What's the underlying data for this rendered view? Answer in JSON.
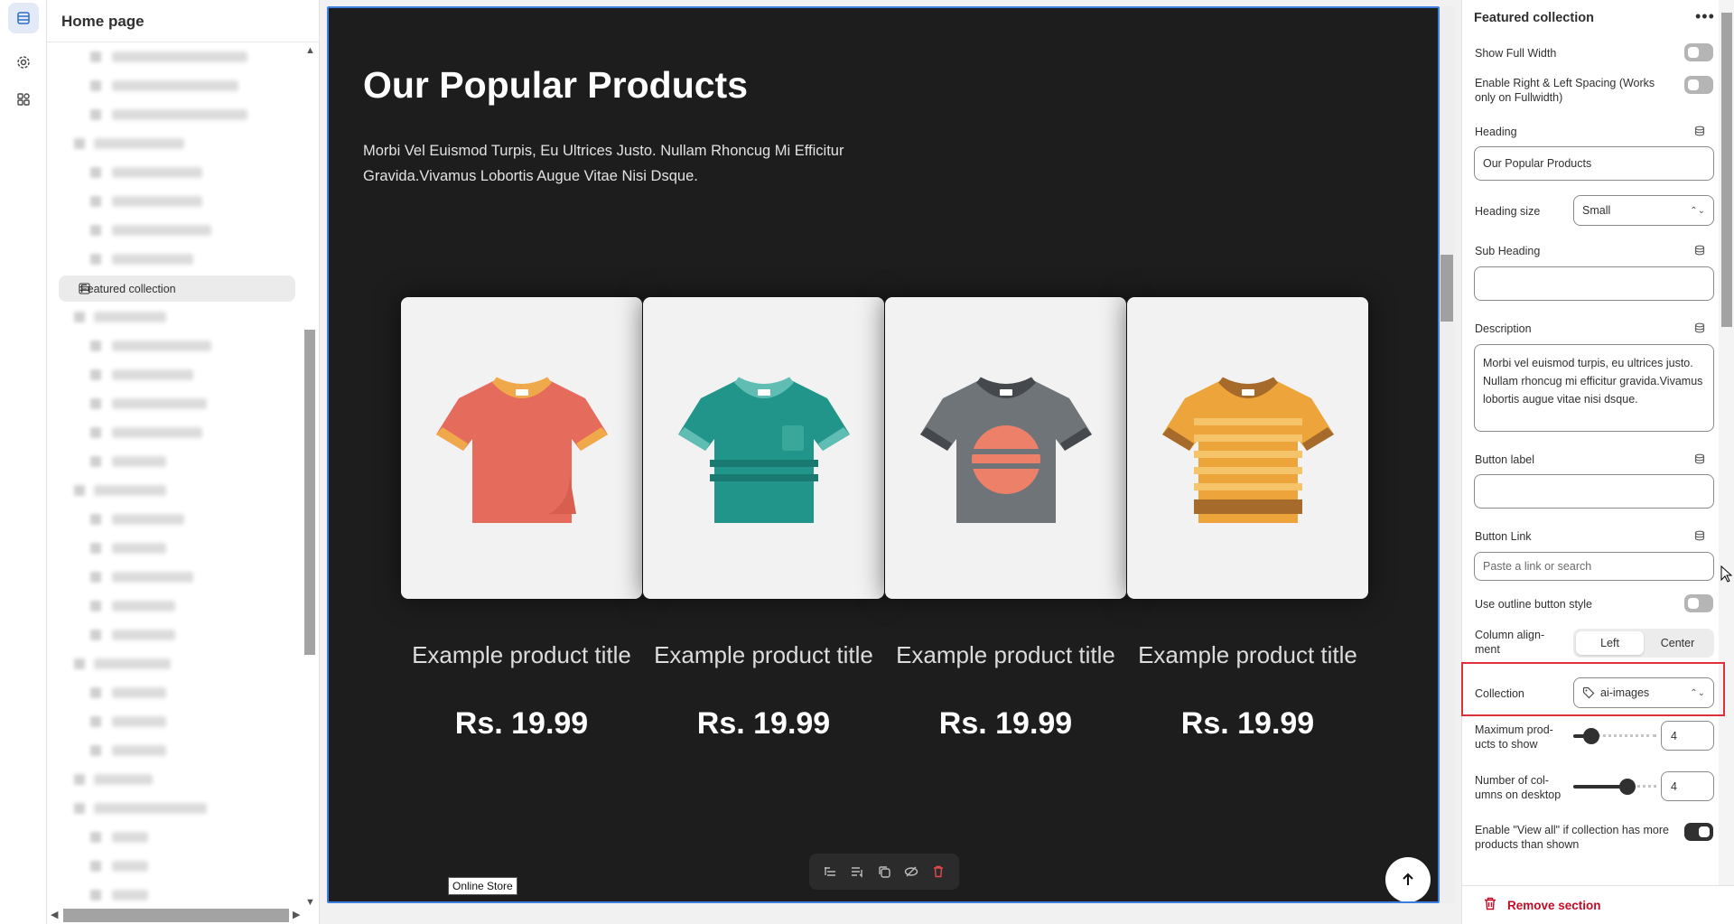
{
  "sidebar": {
    "title": "Home page",
    "selected_item": "Featured collection"
  },
  "canvas": {
    "heading": "Our Popular Products",
    "description": "Morbi Vel Euismod Turpis, Eu Ultrices Justo. Nullam Rhoncug Mi Efficitur Gravida.Vivamus Lobortis Augue Vitae Nisi Dsque.",
    "products": [
      {
        "title": "Example product title",
        "price": "Rs. 19.99",
        "shirt_color": "#e56c5c",
        "trim_color": "#f0a94a"
      },
      {
        "title": "Example product title",
        "price": "Rs. 19.99",
        "shirt_color": "#22958a",
        "trim_color": "#5fbdb3"
      },
      {
        "title": "Example product title",
        "price": "Rs. 19.99",
        "shirt_color": "#6f7479",
        "trim_color": "#45494d"
      },
      {
        "title": "Example product title",
        "price": "Rs. 19.99",
        "shirt_color": "#eda43a",
        "trim_color": "#a66a2a"
      }
    ],
    "badge": "Online Store"
  },
  "panel": {
    "title": "Featured collection",
    "more": "•••",
    "show_full_width": "Show Full Width",
    "enable_spacing": "Enable Right & Left Spacing (Works only on Fullwidth)",
    "heading_label": "Heading",
    "heading_value": "Our Popular Products",
    "heading_size_label": "Heading size",
    "heading_size_value": "Small",
    "sub_heading_label": "Sub Heading",
    "sub_heading_value": "",
    "description_label": "Description",
    "description_value": "Morbi vel euismod turpis, eu ultrices justo. Nullam rhoncug mi efficitur gravida.Vivamus lobortis augue vitae nisi dsque.",
    "button_label_label": "Button label",
    "button_label_value": "",
    "button_link_label": "Button Link",
    "button_link_placeholder": "Paste a link or search",
    "outline_label": "Use outline button style",
    "column_alignment_label": "Column align-ment",
    "alignment_options": [
      "Left",
      "Center"
    ],
    "collection_label": "Collection",
    "collection_value": "ai-images",
    "max_products_label": "Maximum prod-ucts to show",
    "max_products_value": "4",
    "columns_label": "Number of col-umns on desktop",
    "columns_value": "4",
    "view_all_label": "Enable \"View all\" if collection has more products than shown",
    "remove_label": "Remove section",
    "accent_red": "#e0313a"
  }
}
